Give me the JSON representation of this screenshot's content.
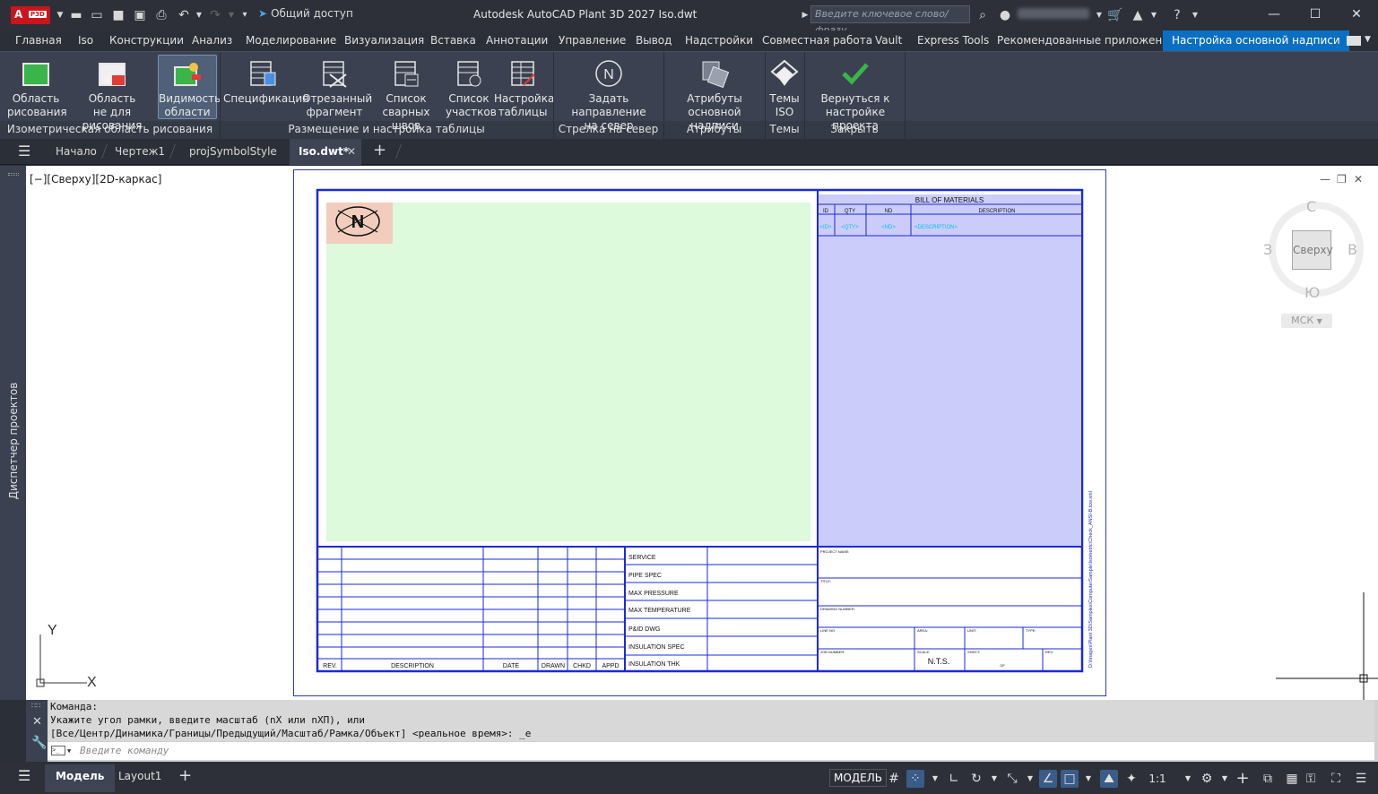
{
  "titlebar": {
    "logo_letter": "A",
    "logo_badge": "P3D",
    "share_label": "Общий доступ",
    "app_title": "Autodesk AutoCAD Plant 3D 2027    Iso.dwt",
    "search_placeholder": "Введите ключевое слово/фразу"
  },
  "ribbon_tabs": [
    "Главная",
    "Iso",
    "Конструкции",
    "Анализ",
    "Моделирование",
    "Визуализация",
    "Вставка",
    "Аннотации",
    "Управление",
    "Вывод",
    "Надстройки",
    "Совместная работа",
    "Vault",
    "Express Tools",
    "Рекомендованные приложения",
    "Настройка основной надписи"
  ],
  "ribbon": {
    "buttons": [
      {
        "l1": "Область",
        "l2": "рисования",
        "icon": "drawing-area-icon"
      },
      {
        "l1": "Область",
        "l2": "не для рисования",
        "icon": "non-drawing-area-icon"
      },
      {
        "l1": "Видимость",
        "l2": "области",
        "icon": "area-visibility-icon"
      },
      {
        "l1": "Спецификация",
        "l2": "",
        "icon": "bom-table-icon"
      },
      {
        "l1": "Отрезанный",
        "l2": "фрагмент",
        "icon": "cut-piece-icon"
      },
      {
        "l1": "Список",
        "l2": "сварных швов",
        "icon": "weld-list-icon"
      },
      {
        "l1": "Список",
        "l2": "участков",
        "icon": "spool-list-icon"
      },
      {
        "l1": "Настройка",
        "l2": "таблицы",
        "icon": "table-setup-icon"
      },
      {
        "l1": "Задать направление",
        "l2": "на север",
        "icon": "north-arrow-icon"
      },
      {
        "l1": "Атрибуты",
        "l2": "основной надписи",
        "icon": "title-attributes-icon"
      },
      {
        "l1": "Темы",
        "l2": "ISO",
        "icon": "iso-themes-icon"
      },
      {
        "l1": "Вернуться к",
        "l2": "настройке проекта",
        "icon": "checkmark-icon"
      }
    ],
    "groups": [
      "Изометрическая область рисования",
      "Размещение и настройка таблицы",
      "Стрелка на север",
      "Атрибуты",
      "Темы",
      "Закрыть"
    ]
  },
  "file_tabs": [
    "Начало",
    "Чертеж1",
    "projSymbolStyle",
    "Iso.dwt*"
  ],
  "sidebar_label": "Диспетчер проектов",
  "viewport": {
    "label": "[−][Сверху][2D-каркас]",
    "viewcube": {
      "face": "Сверху",
      "n": "С",
      "s": "Ю",
      "w": "З",
      "e": "В",
      "wcs": "МСК"
    },
    "north_symbol": "N",
    "axis_x": "X",
    "axis_y": "Y"
  },
  "title_block": {
    "bom_title": "BILL  OF  MATERIALS",
    "bom_headers": [
      "ID",
      "QTY",
      "ND",
      "DESCRIPTION"
    ],
    "bom_placeholders": [
      "<ID>",
      "<QTY>",
      "<ND>",
      "<DESCRIPTION>"
    ],
    "rev_headers": [
      "REV.",
      "DESCRIPTION",
      "DATE",
      "DRAWN",
      "CHKD",
      "APPD"
    ],
    "service_labels": [
      "SERVICE",
      "PIPE  SPEC",
      "MAX  PRESSURE",
      "MAX  TEMPERATURE",
      "P&ID  DWG",
      "INSULATION  SPEC",
      "INSULATION  THK"
    ],
    "project_name": "PROJECT NAME:",
    "title": "TITLE:",
    "drawing_number": "DRAWING NUMBER:",
    "line_no": "LINE NO:",
    "area": "AREA:",
    "unit": "UNIT:",
    "type": "TYPE:",
    "job_number": "JOB NUMBER:",
    "scale": "SCALE:",
    "scale_value": "N.T.S.",
    "sheet": "SHEET:",
    "sheet_of": "OF",
    "rev": "REV:",
    "side_path": "D:\\Images\\Plant 3D\\Samples\\ComputerSample\\Isometric\\Check_ANSI-B.tcw.xml"
  },
  "command": {
    "history": [
      "Команда:",
      "Укажите угол рамки, введите масштаб (nX или nXП), или",
      "[Все/Центр/Динамика/Границы/Предыдущий/Масштаб/Рамка/Объект] <реальное время>: _e"
    ],
    "placeholder": "Введите команду"
  },
  "statusbar": {
    "tabs": [
      "Модель",
      "Layout1"
    ],
    "model_label": "МОДЕЛЬ",
    "scale": "1:1"
  },
  "colors": {
    "accent": "#0a6fc2",
    "drawing_area": "#ddfadd",
    "bom_area": "#ccccfa",
    "north_area": "#f2cdbd",
    "frame": "#1a2ad8"
  }
}
